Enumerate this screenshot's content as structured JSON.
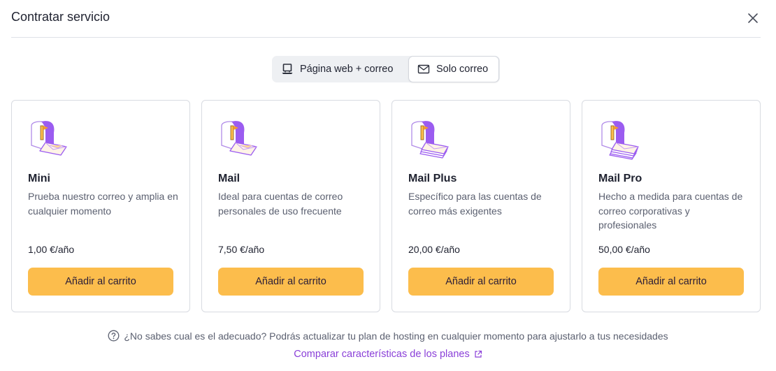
{
  "dialog": {
    "title": "Contratar servicio",
    "close_icon": "close-icon"
  },
  "tabs": [
    {
      "label": "Página web + correo",
      "icon": "computer-icon",
      "selected": false
    },
    {
      "label": "Solo correo",
      "icon": "envelope-icon",
      "selected": true
    }
  ],
  "plans": [
    {
      "name": "Mini",
      "description": "Prueba nuestro correo y amplia en cualquier momento",
      "price": "1,00 €/año",
      "button": "Añadir al carrito",
      "icon": "mailbox-icon"
    },
    {
      "name": "Mail",
      "description": "Ideal para cuentas de correo personales de uso frecuente",
      "price": "7,50 €/año",
      "button": "Añadir al carrito",
      "icon": "mailbox-icon"
    },
    {
      "name": "Mail Plus",
      "description": "Específico para las cuentas de correo más exigentes",
      "price": "20,00 €/año",
      "button": "Añadir al carrito",
      "icon": "mailbox-stack-icon"
    },
    {
      "name": "Mail Pro",
      "description": "Hecho a medida para cuentas de correo corporativas y profesionales",
      "price": "50,00 €/año",
      "button": "Añadir al carrito",
      "icon": "mailbox-stack-icon"
    }
  ],
  "footer": {
    "help_text": "¿No sabes cual es el adecuado? Podrás actualizar tu plan de hosting en cualquier momento para ajustarlo a tus necesidades",
    "compare_link": "Comparar características de los planes",
    "help_icon": "question-circle-icon",
    "external_icon": "external-link-icon"
  },
  "colors": {
    "accent_button": "#fcbd4c",
    "link": "#8a3fd8",
    "illustration_purple": "#9b5cf0"
  }
}
